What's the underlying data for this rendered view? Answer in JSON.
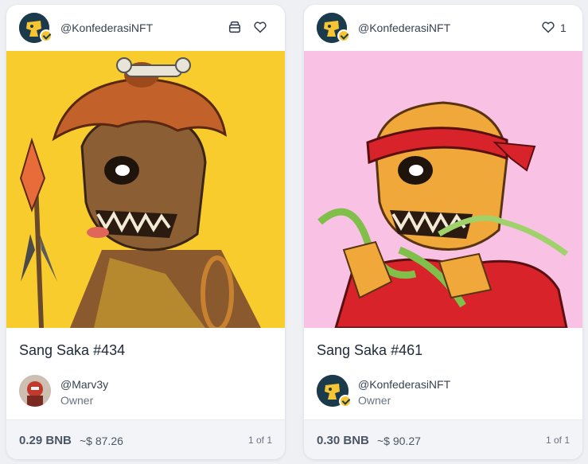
{
  "cards": [
    {
      "creator": "@KonfederasiNFT",
      "title": "Sang Saka #434",
      "owner_name": "@Marv3y",
      "owner_label": "Owner",
      "price": "0.29 BNB",
      "price_usd": "~$ 87.26",
      "edition": "1 of 1",
      "art_bg": "#f9cc2e"
    },
    {
      "creator": "@KonfederasiNFT",
      "likes": "1",
      "title": "Sang Saka #461",
      "owner_name": "@KonfederasiNFT",
      "owner_label": "Owner",
      "price": "0.30 BNB",
      "price_usd": "~$ 90.27",
      "edition": "1 of 1",
      "art_bg": "#f9c2e4"
    }
  ],
  "icons": {
    "stack": "stack-icon",
    "like": "heart-icon",
    "verified": "verified-badge-icon"
  },
  "colors": {
    "accent": "#f6c531",
    "avatar_bg": "#1b3b4d"
  }
}
